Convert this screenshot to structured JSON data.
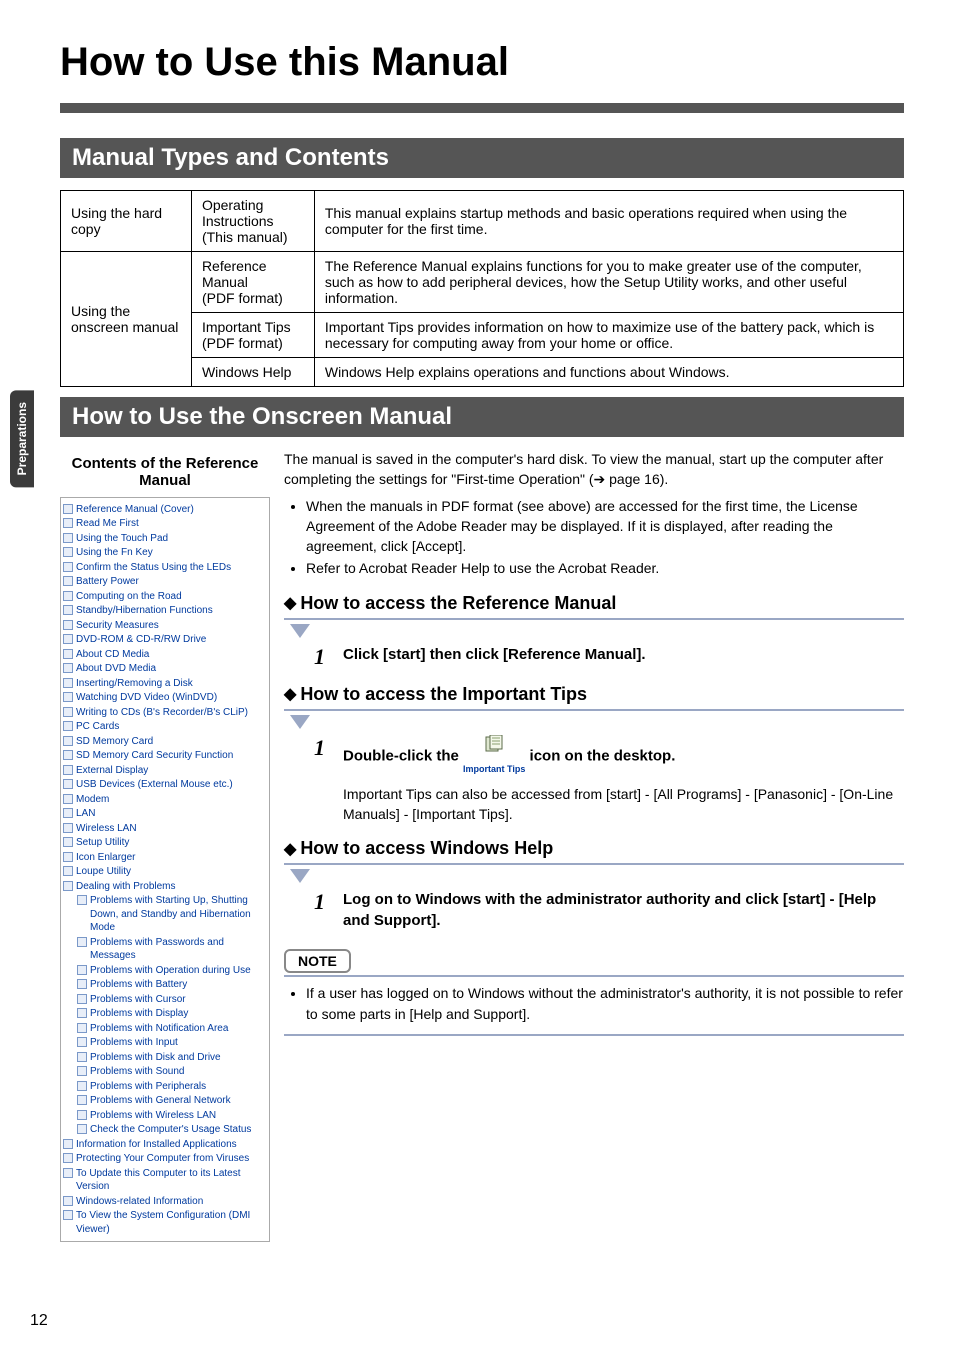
{
  "sideTab": "Preparations",
  "title": "How to Use this Manual",
  "section1": "Manual Types and Contents",
  "table": {
    "r1c1": "Using the hard copy",
    "r1c2": "Operating Instructions\n(This manual)",
    "r1c3": "This manual explains startup methods and basic operations required when using the computer for the first time.",
    "r2c1": "Using the onscreen manual",
    "r2c2a": "Reference Manual\n(PDF format)",
    "r2c3a": "The Reference Manual explains functions for you to make greater use of the computer, such as how to add peripheral devices, how the Setup Utility works, and other useful information.",
    "r2c2b": "Important Tips\n(PDF format)",
    "r2c3b": "Important Tips provides information on how to maximize use of the battery pack, which is necessary for computing away from your home or office.",
    "r2c2c": "Windows Help",
    "r2c3c": "Windows Help explains operations and functions about Windows."
  },
  "section2": "How to Use the Onscreen Manual",
  "contentsHead": "Contents of the Reference Manual",
  "toc": [
    "Reference Manual (Cover)",
    "Read Me First",
    "Using the Touch Pad",
    "Using the Fn Key",
    "Confirm the Status Using the LEDs",
    "Battery Power",
    "Computing on the Road",
    "Standby/Hibernation Functions",
    "Security Measures",
    "DVD-ROM & CD-R/RW Drive",
    "About CD Media",
    "About DVD Media",
    "Inserting/Removing a Disk",
    "Watching DVD Video (WinDVD)",
    "Writing to CDs (B's Recorder/B's CLiP)",
    "PC Cards",
    "SD Memory Card",
    "SD Memory Card Security Function",
    "External Display",
    "USB Devices (External Mouse etc.)",
    "Modem",
    "LAN",
    "Wireless LAN",
    "Setup Utility",
    "Icon Enlarger",
    "Loupe Utility",
    "Dealing with Problems",
    "Problems with Starting Up, Shutting Down, and Standby and Hibernation Mode",
    "Problems with Passwords and Messages",
    "Problems with Operation during Use",
    "Problems with Battery",
    "Problems with Cursor",
    "Problems with Display",
    "Problems with Notification Area",
    "Problems with Input",
    "Problems with Disk and Drive",
    "Problems with Sound",
    "Problems with Peripherals",
    "Problems with General Network",
    "Problems with Wireless LAN",
    "Check the Computer's Usage Status",
    "Information for Installed Applications",
    "Protecting Your Computer from Viruses",
    "To Update this Computer to its Latest Version",
    "Windows-related Information",
    "To View the System Configuration (DMI Viewer)"
  ],
  "intro1": "The manual is saved in the computer's hard disk.  To view the manual, start up the computer after completing the settings for \"First-time Operation\" (",
  "introPage": " page 16).",
  "bullet1": "When the manuals in PDF format (see above) are accessed for the first time, the License Agreement of the Adobe Reader may be displayed. If it is displayed, after reading the agreement, click [Accept].",
  "bullet2": "Refer to Acrobat Reader Help to use the Acrobat Reader.",
  "subA": "How to access the Reference Manual",
  "stepA1": "Click [start] then click [Reference Manual].",
  "subB": "How to access the Important Tips",
  "stepB1a": "Double-click the ",
  "stepB1b": " icon on the desktop.",
  "iconCaption": "Important Tips",
  "stepB1sub": "Important Tips can also be accessed from [start] - [All Programs] - [Panasonic] - [On-Line Manuals] - [Important Tips].",
  "subC": "How to access Windows Help",
  "stepC1": "Log on to Windows with the administrator authority and click [start] - [Help and Support].",
  "noteLabel": "NOTE",
  "noteBullet": "If a user has logged on to Windows without the administrator's authority, it is not possible to refer to some parts in [Help and Support].",
  "pageNum": "12"
}
